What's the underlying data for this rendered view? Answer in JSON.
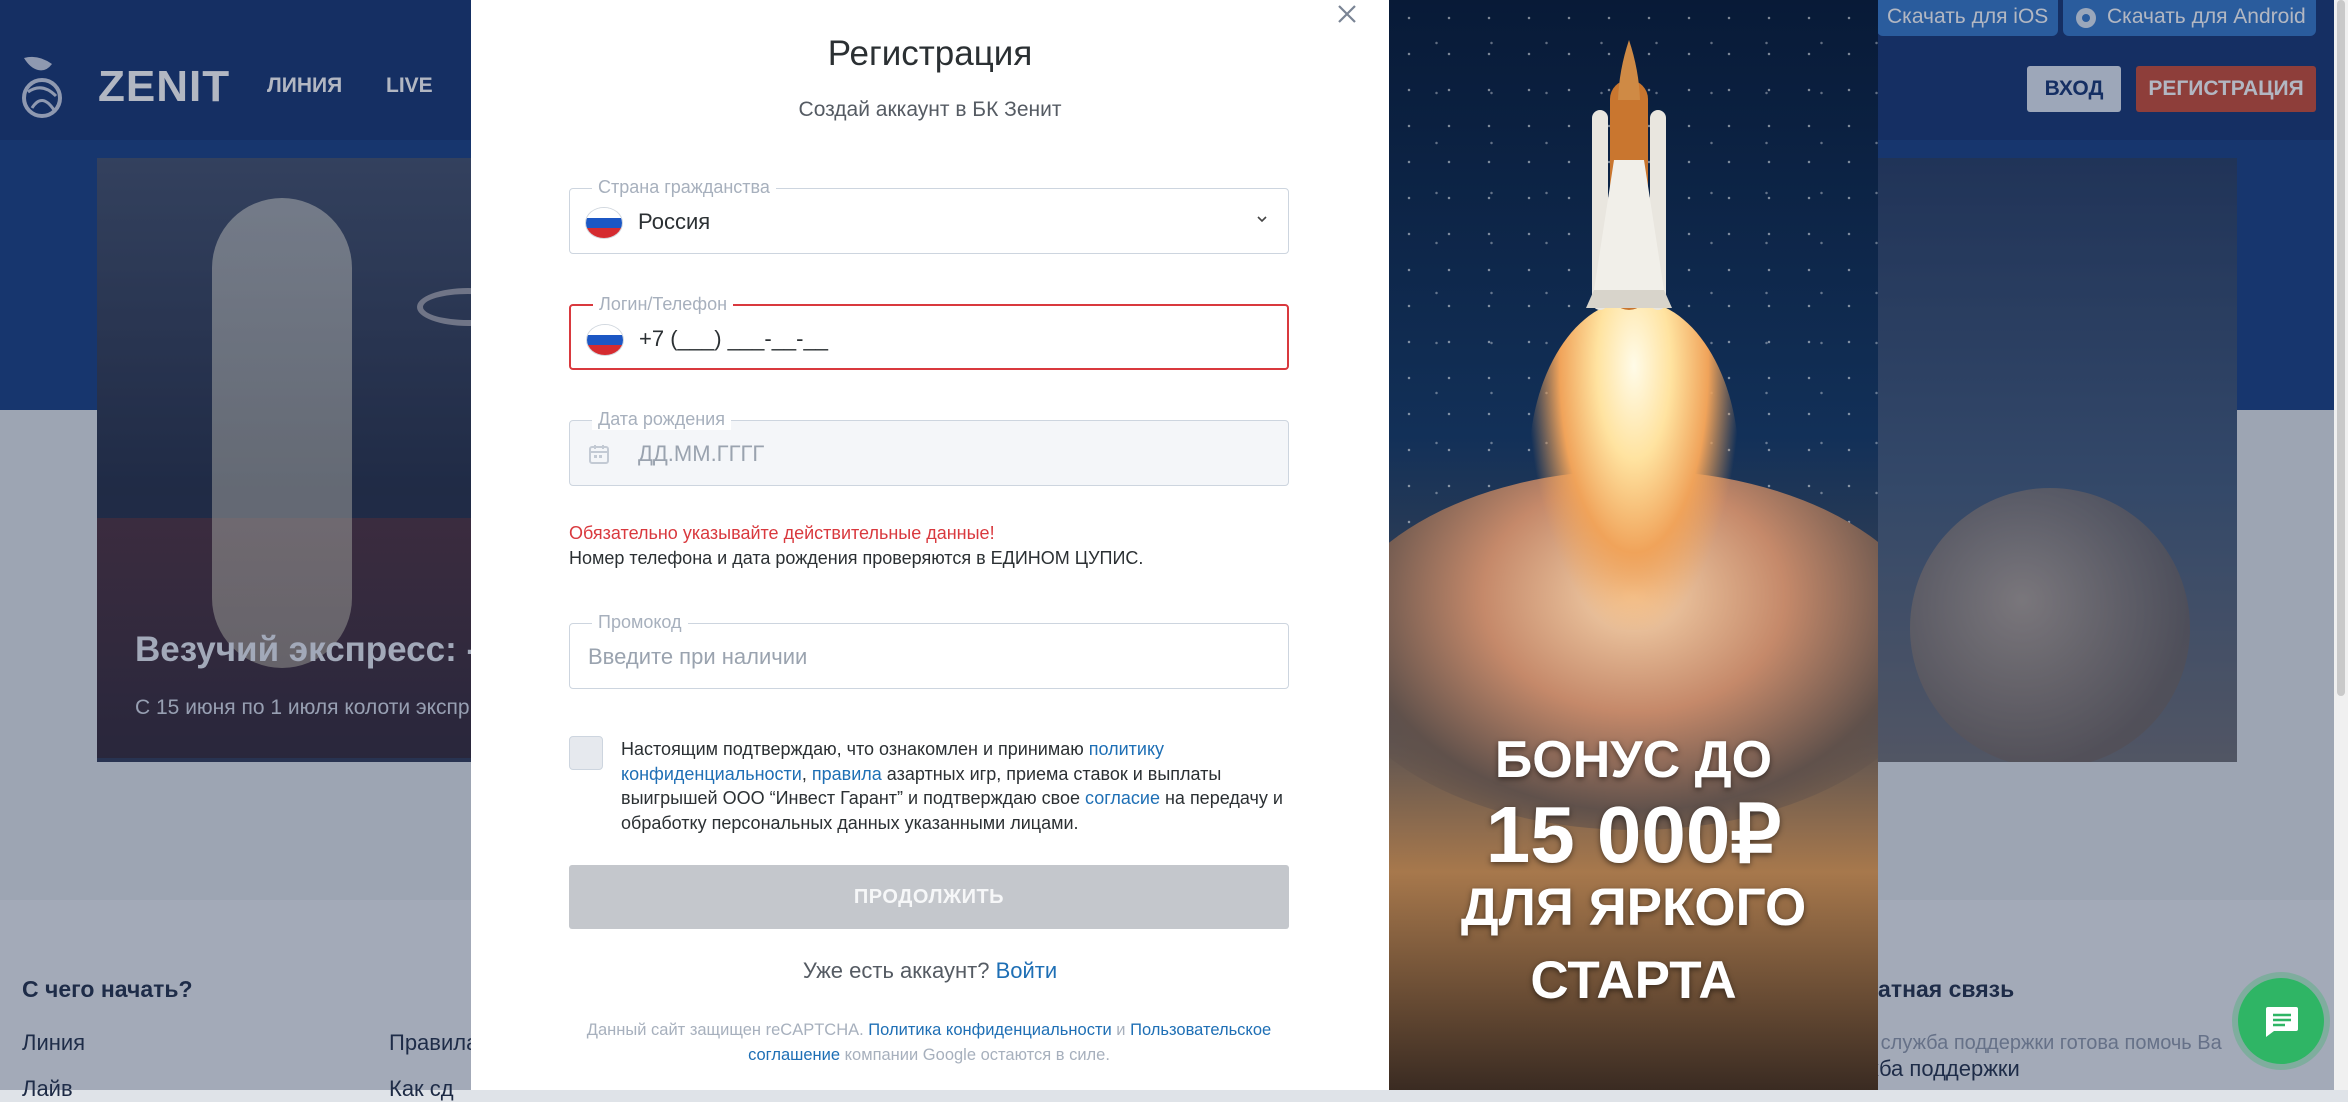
{
  "site": {
    "logo_text": "ZENIT",
    "nav": [
      "ЛИНИЯ",
      "LIVE"
    ],
    "download_ios": "Скачать для iOS",
    "download_android": "Скачать для Android",
    "login_button": "ВХОД",
    "register_button": "РЕГИСТРАЦИЯ",
    "banner_title": "Везучий экспресс: -",
    "banner_subtitle": "С 15 июня по 1 июля колоти экспр",
    "footer": {
      "col1_heading": "С чего начать?",
      "col1_links": [
        "Линия",
        "Лайв"
      ],
      "col2_links": [
        "Правила",
        "Как сд"
      ],
      "col3_heading": "ратная связь",
      "col3_text": "а служба поддержки готова помочь Ва",
      "col3_link": "жба поддержки"
    }
  },
  "modal": {
    "title": "Регистрация",
    "subtitle": "Создай аккаунт в БК Зенит",
    "country": {
      "label": "Страна гражданства",
      "value": "Россия"
    },
    "phone": {
      "label": "Логин/Телефон",
      "value": "+7 (___) ___-__-__"
    },
    "birthdate": {
      "label": "Дата рождения",
      "placeholder": "ДД.ММ.ГГГГ"
    },
    "warning": "Обязательно указывайте действительные данные!",
    "warning_note": "Номер телефона и дата рождения проверяются в ЕДИНОМ ЦУПИС.",
    "promocode": {
      "label": "Промокод",
      "placeholder": "Введите при наличии"
    },
    "consent": {
      "t1": "Настоящим подтверждаю, что ознакомлен и принимаю ",
      "l1": "политику конфиденциальности",
      "t2": ", ",
      "l2": "правила",
      "t3": " азартных игр, приема ставок и выплаты выигрышей ООО “Инвест Гарант” и подтверждаю свое ",
      "l3": "согласие",
      "t4": " на передачу и обработку персональных данных указанными лицами."
    },
    "continue_button": "ПРОДОЛЖИТЬ",
    "have_account": "Уже есть аккаунт?",
    "login_link": "Войти",
    "captcha": {
      "t1": "Данный сайт защищен reCAPTCHA. ",
      "l1": "Политика конфиденциальности",
      "t2": " и ",
      "l2": "Пользовательское соглашение",
      "t3": "  компании Google остаются в силе."
    }
  },
  "promo": {
    "line1": "БОНУС ДО",
    "line2": "15 000₽",
    "line3": "ДЛЯ ЯРКОГО",
    "line4": "СТАРТА"
  },
  "colors": {
    "accent_link": "#1e6fb5",
    "error": "#d9393e",
    "register_red": "#c8452e",
    "site_navy": "#0f2e6d",
    "chat_green": "#2fb565"
  },
  "icons": [
    "close-icon",
    "chevron-down-icon",
    "calendar-icon",
    "russia-flag-icon",
    "android-icon",
    "chat-icon",
    "zenit-logo-icon"
  ]
}
